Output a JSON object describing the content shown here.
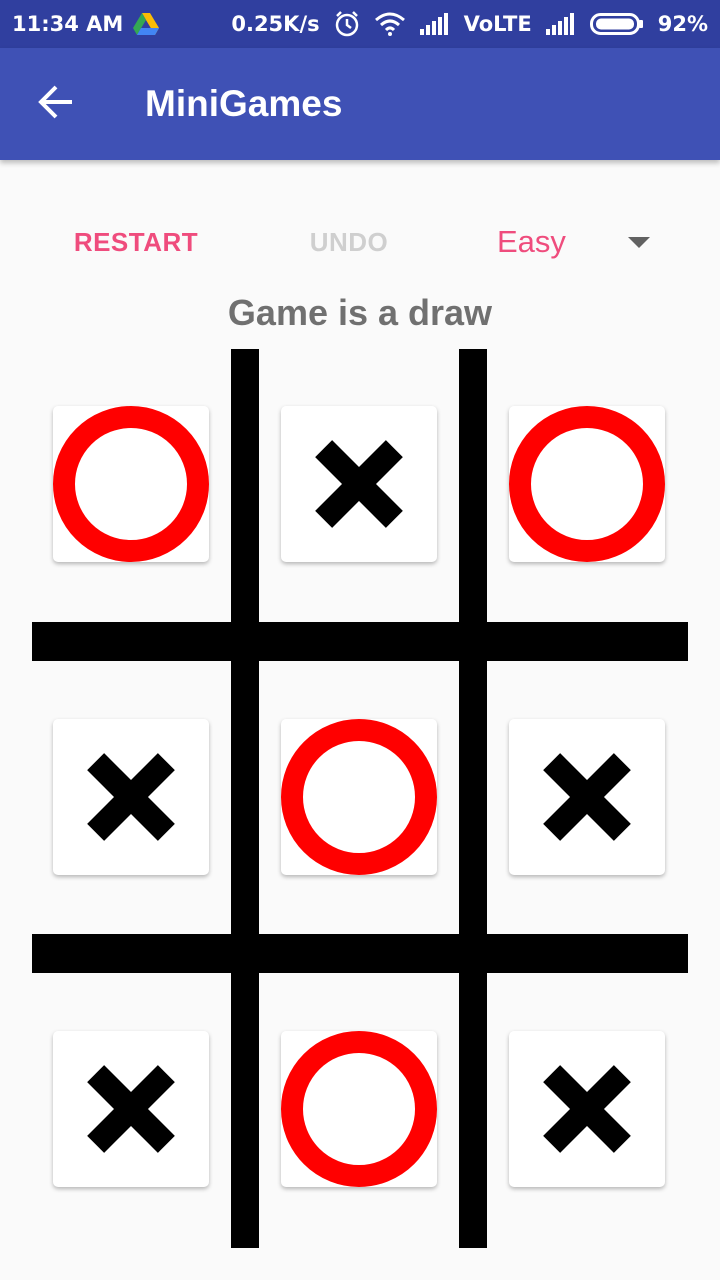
{
  "status_bar": {
    "time": "11:34 AM",
    "network_speed": "0.25K/s",
    "network_type": "VoLTE",
    "battery": "92%",
    "icons": [
      "drive-icon",
      "alarm-icon",
      "wifi-icon",
      "signal-icon",
      "signal-icon",
      "battery-icon"
    ]
  },
  "app_bar": {
    "title": "MiniGames",
    "back_icon": "arrow-back-icon",
    "color": "#3f51b5"
  },
  "controls": {
    "restart_label": "RESTART",
    "undo_label": "UNDO",
    "difficulty_selected": "Easy",
    "accent_color": "#ef4c7d",
    "disabled_color": "#cfcfcf"
  },
  "game": {
    "status": "Game is a draw",
    "board": [
      [
        "O",
        "X",
        "O"
      ],
      [
        "X",
        "O",
        "X"
      ],
      [
        "X",
        "O",
        "X"
      ]
    ],
    "o_color": "#ff0000",
    "x_color": "#000000"
  }
}
